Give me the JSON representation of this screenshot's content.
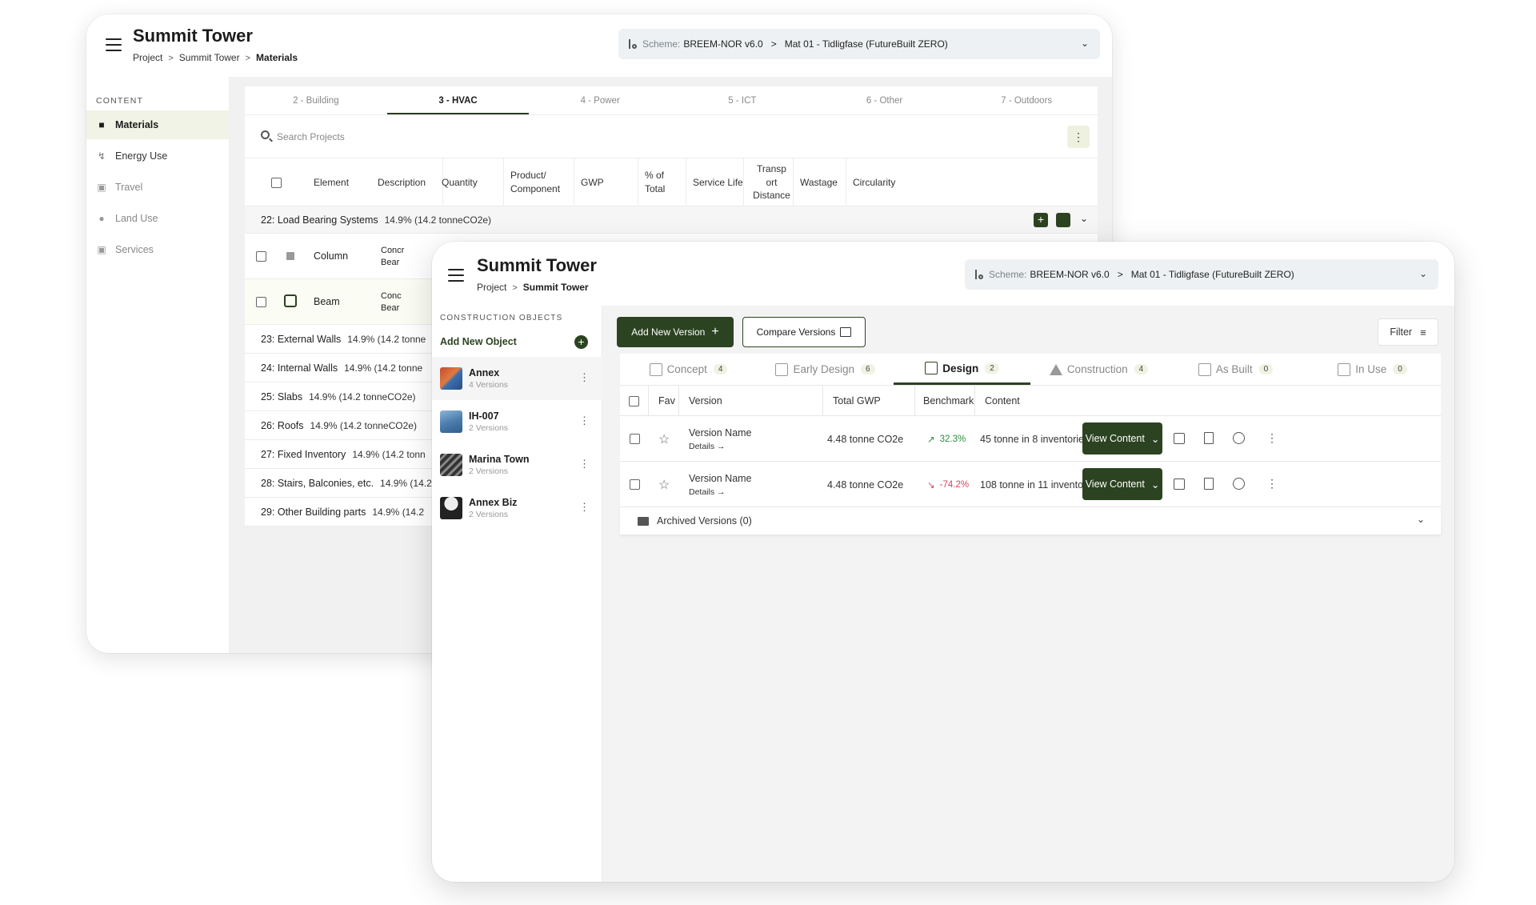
{
  "back_window": {
    "title": "Summit Tower",
    "breadcrumb": [
      "Project",
      "Summit Tower",
      "Materials"
    ],
    "scheme": {
      "label": "Scheme:",
      "name": "BREEM-NOR v6.0",
      "target": "Mat 01 - Tidligfase (FutureBuilt ZERO)"
    },
    "sidebar": {
      "heading": "CONTENT",
      "items": [
        {
          "label": "Materials",
          "icon": "cube-icon",
          "active": true
        },
        {
          "label": "Energy Use",
          "icon": "bolt-icon"
        },
        {
          "label": "Travel",
          "icon": "truck-icon"
        },
        {
          "label": "Land Use",
          "icon": "tree-icon"
        },
        {
          "label": "Services",
          "icon": "briefcase-icon"
        }
      ]
    },
    "tabs": [
      "2 - Building",
      "3 - HVAC",
      "4 - Power",
      "5 - ICT",
      "6 - Other",
      "7 - Outdoors"
    ],
    "active_tab": "3 - HVAC",
    "search_placeholder": "Search Projects",
    "columns": [
      "Element",
      "Description",
      "Quantity",
      "Product/ Component",
      "GWP",
      "% of Total",
      "Service Life",
      "Transp ort Distance",
      "Wastage",
      "Circularity"
    ],
    "group": {
      "name": "22: Load Bearing Systems",
      "pct": "14.9% (14.2 tonneCO2e)"
    },
    "sub_rows": [
      {
        "element": "Column",
        "description": "Concr\nBear"
      },
      {
        "element": "Beam",
        "description": "Conc\nBear"
      }
    ],
    "rows": [
      {
        "name": "23: External Walls",
        "pct": "14.9% (14.2 tonne"
      },
      {
        "name": "24: Internal Walls",
        "pct": "14.9% (14.2 tonne"
      },
      {
        "name": "25: Slabs",
        "pct": "14.9% (14.2 tonneCO2e)"
      },
      {
        "name": "26: Roofs",
        "pct": "14.9% (14.2 tonneCO2e)"
      },
      {
        "name": "27: Fixed Inventory",
        "pct": "14.9% (14.2 tonn"
      },
      {
        "name": "28: Stairs, Balconies, etc.",
        "pct": "14.9% (14.2"
      },
      {
        "name": "29: Other Building parts",
        "pct": "14.9% (14.2"
      }
    ]
  },
  "front_window": {
    "title": "Summit Tower",
    "breadcrumb": [
      "Project",
      "Summit Tower"
    ],
    "scheme": {
      "label": "Scheme:",
      "name": "BREEM-NOR v6.0",
      "target": "Mat 01 - Tidligfase (FutureBuilt ZERO)"
    },
    "sidebar": {
      "heading": "CONSTRUCTION OBJECTS",
      "add_label": "Add New Object",
      "objects": [
        {
          "name": "Annex",
          "versions": "4 Versions",
          "active": true
        },
        {
          "name": "IH-007",
          "versions": "2 Versions"
        },
        {
          "name": "Marina Town",
          "versions": "2 Versions"
        },
        {
          "name": "Annex Biz",
          "versions": "2 Versions"
        }
      ]
    },
    "toolbar": {
      "add_version": "Add New Version",
      "compare": "Compare Versions",
      "filter": "Filter"
    },
    "phase_tabs": [
      {
        "label": "Concept",
        "count": "4"
      },
      {
        "label": "Early Design",
        "count": "6"
      },
      {
        "label": "Design",
        "count": "2",
        "active": true
      },
      {
        "label": "Construction",
        "count": "4"
      },
      {
        "label": "As Built",
        "count": "0"
      },
      {
        "label": "In Use",
        "count": "0"
      }
    ],
    "columns": [
      "Fav",
      "Version",
      "Total GWP",
      "Benchmark",
      "Content"
    ],
    "versions": [
      {
        "name": "Version Name",
        "details": "Details",
        "gwp": "4.48 tonne CO2e",
        "benchmark": "32.3%",
        "trend": "up",
        "content": "45 tonne in 8 inventories",
        "action": "View Content"
      },
      {
        "name": "Version Name",
        "details": "Details",
        "gwp": "4.48 tonne CO2e",
        "benchmark": "-74.2%",
        "trend": "down",
        "content": "108 tonne in 11 inventories",
        "action": "View Content"
      }
    ],
    "archived": "Archived Versions (0)",
    "colors": {
      "brand_dark": "#2c4321",
      "positive": "#2f8a3c",
      "negative": "#d6455d"
    }
  }
}
